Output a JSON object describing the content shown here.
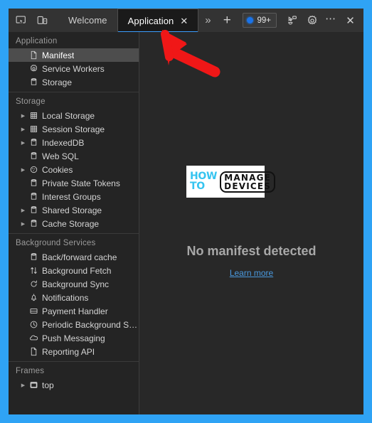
{
  "window": {
    "border_color": "#2fa3f5",
    "background": "#242424"
  },
  "toolbar": {
    "inspect_icon": "inspect-element-icon",
    "device_toggle_icon": "device-toolbar-icon",
    "tabs": [
      {
        "label": "Welcome",
        "active": false,
        "closable": false
      },
      {
        "label": "Application",
        "active": true,
        "closable": true,
        "close_label": "✕"
      }
    ],
    "more_tabs_label": "»",
    "new_tab_label": "+",
    "badge": {
      "text": "99+",
      "dot_color": "#1a73e8"
    },
    "cursor_icon": "cursor-recording-icon",
    "settings_icon": "gear-icon",
    "more_label": "⋯",
    "close_label": "✕"
  },
  "sidebar": {
    "sections": [
      {
        "title": "Application",
        "items": [
          {
            "label": "Manifest",
            "icon": "document-icon",
            "expandable": false,
            "selected": true
          },
          {
            "label": "Service Workers",
            "icon": "gear-icon",
            "expandable": false,
            "selected": false
          },
          {
            "label": "Storage",
            "icon": "database-icon",
            "expandable": false,
            "selected": false
          }
        ]
      },
      {
        "title": "Storage",
        "items": [
          {
            "label": "Local Storage",
            "icon": "table-icon",
            "expandable": true,
            "selected": false
          },
          {
            "label": "Session Storage",
            "icon": "table-icon",
            "expandable": true,
            "selected": false
          },
          {
            "label": "IndexedDB",
            "icon": "database-icon",
            "expandable": true,
            "selected": false
          },
          {
            "label": "Web SQL",
            "icon": "database-icon",
            "expandable": false,
            "selected": false
          },
          {
            "label": "Cookies",
            "icon": "cookie-icon",
            "expandable": true,
            "selected": false
          },
          {
            "label": "Private State Tokens",
            "icon": "database-icon",
            "expandable": false,
            "selected": false
          },
          {
            "label": "Interest Groups",
            "icon": "database-icon",
            "expandable": false,
            "selected": false
          },
          {
            "label": "Shared Storage",
            "icon": "database-icon",
            "expandable": true,
            "selected": false
          },
          {
            "label": "Cache Storage",
            "icon": "database-icon",
            "expandable": true,
            "selected": false
          }
        ]
      },
      {
        "title": "Background Services",
        "items": [
          {
            "label": "Back/forward cache",
            "icon": "database-icon",
            "expandable": false,
            "selected": false
          },
          {
            "label": "Background Fetch",
            "icon": "arrows-updown-icon",
            "expandable": false,
            "selected": false
          },
          {
            "label": "Background Sync",
            "icon": "sync-icon",
            "expandable": false,
            "selected": false
          },
          {
            "label": "Notifications",
            "icon": "bell-icon",
            "expandable": false,
            "selected": false
          },
          {
            "label": "Payment Handler",
            "icon": "card-icon",
            "expandable": false,
            "selected": false
          },
          {
            "label": "Periodic Background Sync",
            "icon": "clock-icon",
            "expandable": false,
            "selected": false
          },
          {
            "label": "Push Messaging",
            "icon": "cloud-icon",
            "expandable": false,
            "selected": false
          },
          {
            "label": "Reporting API",
            "icon": "document-icon",
            "expandable": false,
            "selected": false
          }
        ]
      },
      {
        "title": "Frames",
        "items": [
          {
            "label": "top",
            "icon": "frame-icon",
            "expandable": true,
            "selected": false
          }
        ]
      }
    ]
  },
  "main": {
    "watermark": {
      "how": "HOW",
      "to": "TO",
      "manage": "MANAGE",
      "devices": "DEVICES",
      "accent_color": "#36c4f0"
    },
    "empty_title": "No manifest detected",
    "empty_link": "Learn more"
  },
  "annotation": {
    "type": "arrow",
    "color": "#f01717",
    "points_to": "Application tab"
  }
}
